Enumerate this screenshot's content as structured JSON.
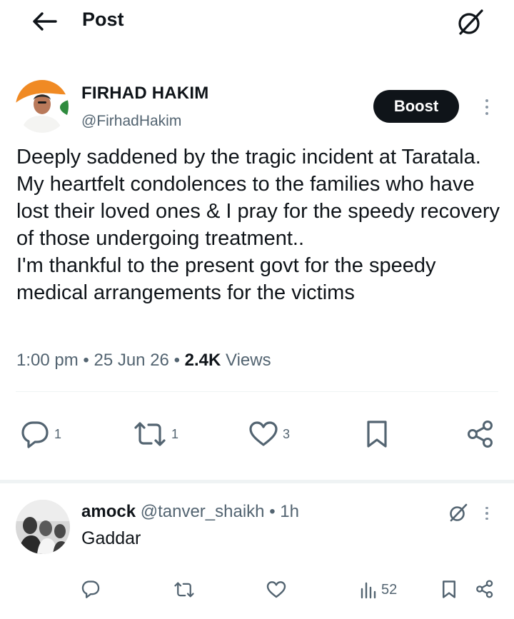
{
  "header": {
    "title": "Post",
    "back_icon": "arrow-left-icon",
    "grok_icon": "grok-icon"
  },
  "post": {
    "author_name": "FIRHAD HAKIM",
    "author_handle": "@FirhadHakim",
    "boost_label": "Boost",
    "text_lines": [
      "Deeply saddened by the tragic incident at Taratala. My heartfelt condolences to the families who have lost their loved ones & I pray for the speedy recovery of those undergoing treatment..",
      "I'm thankful to the present govt for the speedy medical arrangements for the victims"
    ],
    "time": "1:00 pm",
    "date": "25 Jun 26",
    "separator": "•",
    "views_count": "2.4K",
    "views_label": "Views",
    "actions": {
      "reply_count": "1",
      "repost_count": "1",
      "like_count": "3"
    },
    "colors": {
      "avatar_saffron": "#f08a24",
      "avatar_green": "#2e8b3e",
      "text_primary": "#0f1419",
      "text_secondary": "#536471"
    }
  },
  "reply": {
    "name": "amock",
    "handle": "@tanver_shaikh",
    "separator": "•",
    "time": "1h",
    "text": "Gaddar",
    "views_count": "52"
  }
}
